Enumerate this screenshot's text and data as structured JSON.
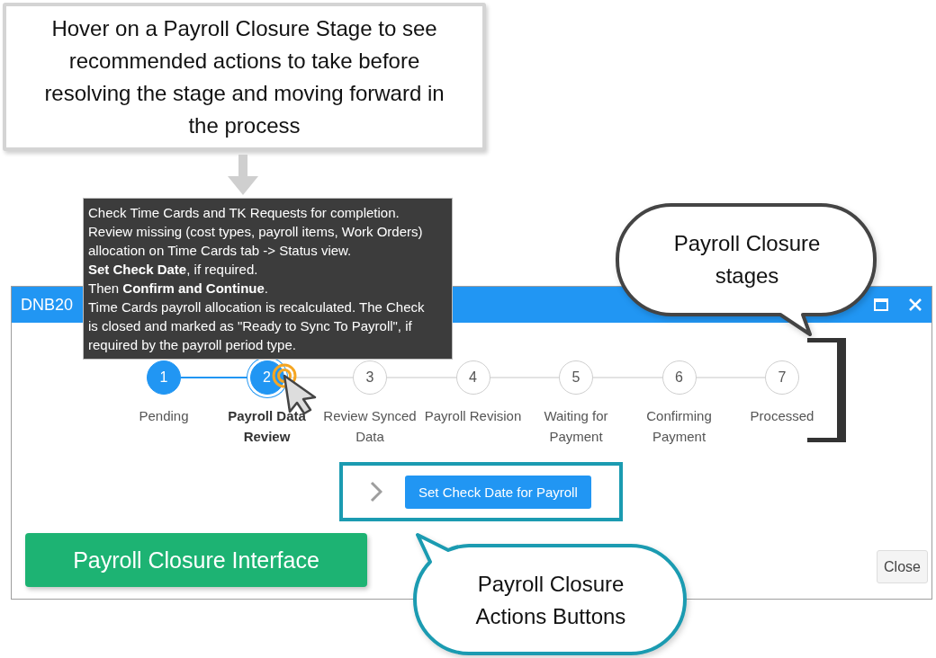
{
  "callout": {
    "text": "Hover on a Payroll Closure Stage to see recommended actions to take before resolving the stage and moving forward in the process"
  },
  "tooltip": {
    "paragraphs": [
      "Check Time Cards and TK Requests for completion.",
      "Review missing (cost types, payroll items, Work Orders) allocation on Time Cards tab -> Status view.",
      "**Set Check Date**, if required.",
      "Then **Confirm and Continue**.",
      "Time Cards payroll allocation is recalculated. The Check is closed and marked as \"Ready to Sync To Payroll\", if required by the payroll period type."
    ]
  },
  "stages_bubble": {
    "text": "Payroll Closure stages"
  },
  "dialog": {
    "title": "DNB20",
    "stages": [
      {
        "number": "1",
        "label": "Pending",
        "completed": true,
        "selected": false
      },
      {
        "number": "2",
        "label": "Payroll Data Review",
        "completed": false,
        "selected": true
      },
      {
        "number": "3",
        "label": "Review Synced Data",
        "completed": false,
        "selected": false
      },
      {
        "number": "4",
        "label": "Payroll Revision",
        "completed": false,
        "selected": false
      },
      {
        "number": "5",
        "label": "Waiting for Payment",
        "completed": false,
        "selected": false
      },
      {
        "number": "6",
        "label": "Confirming Payment",
        "completed": false,
        "selected": false
      },
      {
        "number": "7",
        "label": "Processed",
        "completed": false,
        "selected": false
      }
    ],
    "actions": [
      {
        "label": "Set Check Date for Payroll"
      }
    ],
    "close_button": "Close"
  },
  "interface_label": {
    "text": "Payroll Closure Interface"
  },
  "actions_bubble": {
    "text": "Payroll Closure Actions Buttons"
  }
}
